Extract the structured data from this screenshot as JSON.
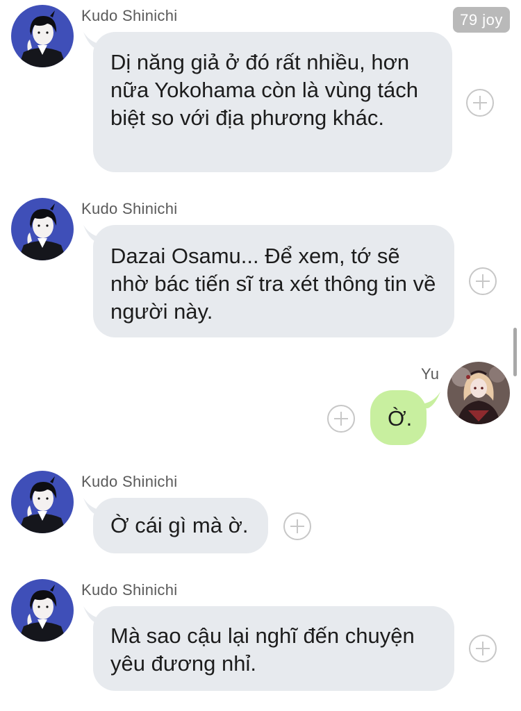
{
  "header_badge": "79 joy",
  "messages": [
    {
      "sender": "Kudo Shinichi",
      "text": "Dị năng giả ở đó rất nhiều, hơn nữa Yokohama còn là vùng tách biệt so với địa phương khác."
    },
    {
      "sender": "Kudo Shinichi",
      "text": "Dazai Osamu... Để xem, tớ sẽ nhờ bác tiến sĩ tra xét thông tin về người này."
    },
    {
      "sender": "Yu",
      "text": "Ờ."
    },
    {
      "sender": "Kudo Shinichi",
      "text": "Ờ cái gì mà ờ."
    },
    {
      "sender": "Kudo Shinichi",
      "text": "Mà sao cậu lại nghĩ đến chuyện yêu đương nhỉ."
    }
  ],
  "icons": {
    "add_reaction": "plus-circle-icon",
    "avatar_incoming": "kudo-avatar-icon",
    "avatar_outgoing": "yu-avatar-icon"
  },
  "colors": {
    "incoming_bubble": "#e7eaee",
    "outgoing_bubble": "#c8ef9f",
    "badge": "#b9b9b9"
  }
}
